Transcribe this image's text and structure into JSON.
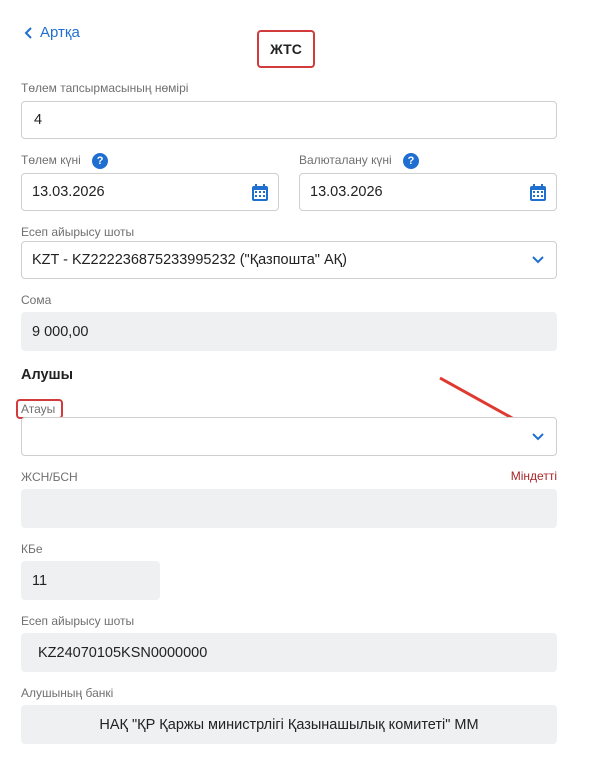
{
  "nav": {
    "back_label": "Артқа"
  },
  "page": {
    "title": "ЖТС"
  },
  "form": {
    "payment_order_number": {
      "label": "Төлем тапсырмасының нөмірі",
      "value": "4"
    },
    "payment_date": {
      "label": "Төлем күні",
      "help": "?",
      "value": "13.03.2026"
    },
    "value_date": {
      "label": "Валюталану күні",
      "help": "?",
      "value": "13.03.2026"
    },
    "settlement_account": {
      "label": "Есеп айырысу шоты",
      "value": "KZT - KZ222236875233995232 (\"Қазпошта\" АҚ)"
    },
    "amount": {
      "label": "Сома",
      "value": "9 000,00"
    }
  },
  "recipient": {
    "section_title": "Алушы",
    "name": {
      "label": "Атауы",
      "value": ""
    },
    "iin_bin": {
      "label": "ЖСН/БСН",
      "required_label": "Міндетті",
      "value": ""
    },
    "kbe": {
      "label": "КБе",
      "value": "11"
    },
    "account": {
      "label": "Есеп айырысу шоты",
      "value": "KZ24070105KSN0000000"
    },
    "bank": {
      "label": "Алушының банкі",
      "value": "НАҚ \"ҚР Қаржы министрлігі Қазынашылық комитеті\" ММ"
    }
  },
  "colors": {
    "accent": "#1f6fd1",
    "highlight": "#d23b3b",
    "required": "#a7252a",
    "readonly_bg": "#eef0f2"
  }
}
